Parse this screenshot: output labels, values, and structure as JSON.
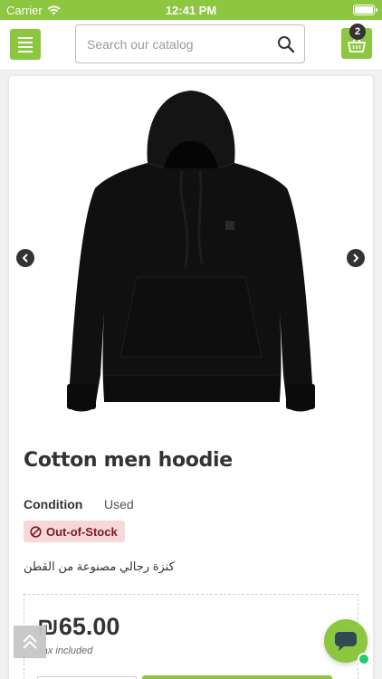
{
  "status_bar": {
    "carrier": "Carrier",
    "time": "12:41 PM"
  },
  "header": {
    "search_placeholder": "Search our catalog",
    "cart_count": "2"
  },
  "product": {
    "title": "Cotton men hoodie",
    "condition_label": "Condition",
    "condition_value": "Used",
    "stock_status": "Out-of-Stock",
    "description": "كنزة رجالي مصنوعة من القطن",
    "price": "₪65.00",
    "tax_note": "Tax included"
  },
  "colors": {
    "accent": "#8dc63f",
    "out_of_stock_bg": "#f8d7da",
    "out_of_stock_text": "#7a1a23"
  },
  "icons": [
    "wifi-icon",
    "battery-icon",
    "menu-icon",
    "search-icon",
    "basket-icon",
    "chevron-left-icon",
    "chevron-right-icon",
    "ban-icon",
    "scroll-top-icon",
    "chat-icon"
  ]
}
